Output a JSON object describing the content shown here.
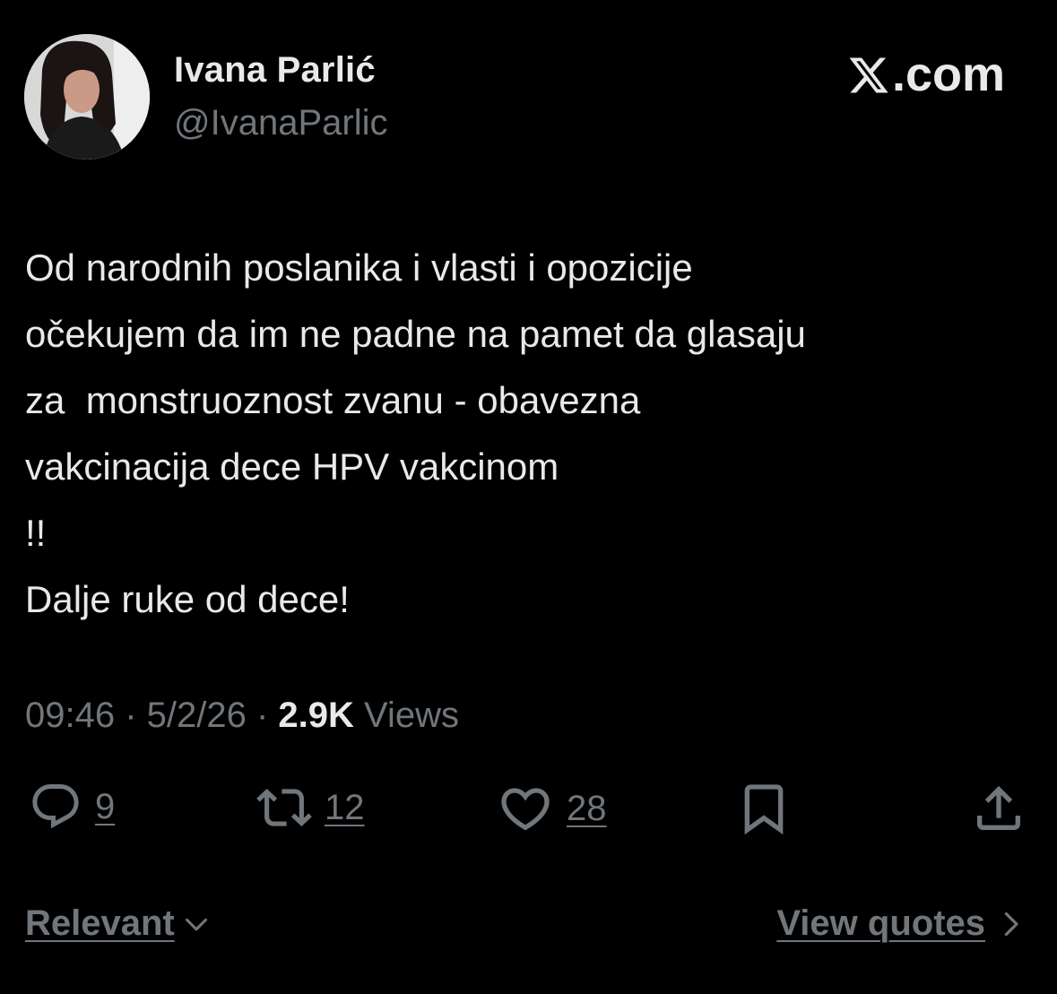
{
  "author": {
    "name": "Ivana Parlić",
    "handle": "@IvanaParlic"
  },
  "brand": {
    "label": ".com",
    "icon": "x-logo-icon"
  },
  "tweet": {
    "lines": [
      "Od narodnih poslanika i vlasti i opozicije",
      "očekujem da im ne padne na pamet da glasaju",
      "za  monstruoznost zvanu - obavezna",
      "vakcinacija dece HPV vakcinom",
      "!!",
      "Dalje ruke od dece!"
    ]
  },
  "meta": {
    "time": "09:46",
    "separator": " · ",
    "date": "5/2/26",
    "views_count": "2.9K",
    "views_label": " Views"
  },
  "actions": {
    "replies": "9",
    "reposts": "12",
    "likes": "28"
  },
  "footer": {
    "sort_label": "Relevant",
    "quotes_label": "View quotes"
  },
  "colors": {
    "background": "#000000",
    "text_primary": "#e7e9ea",
    "text_secondary": "#71767b"
  }
}
